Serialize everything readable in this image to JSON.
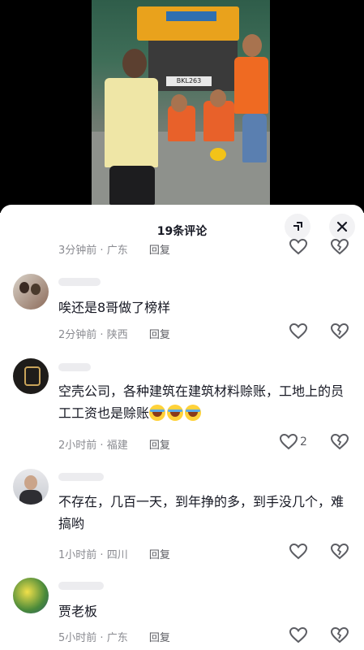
{
  "video": {
    "plate_text": "BKL263",
    "description_icon": "video-frame"
  },
  "sheet": {
    "title": "19条评论",
    "collapse_icon": "collapse-icon",
    "close_icon": "close-icon"
  },
  "comments": [
    {
      "meta_time": "3分钟前",
      "meta_loc": "广东",
      "reply": "回复",
      "text": "",
      "likes": ""
    },
    {
      "meta_time": "2分钟前",
      "meta_loc": "陕西",
      "reply": "回复",
      "text": "唉还是8哥做了榜样",
      "likes": ""
    },
    {
      "meta_time": "2小时前",
      "meta_loc": "福建",
      "reply": "回复",
      "text": "空壳公司，各种建筑在建筑材料赊账，工地上的员工工资也是赊账",
      "likes": "2"
    },
    {
      "meta_time": "1小时前",
      "meta_loc": "四川",
      "reply": "回复",
      "text": "不存在，几百一天，到年挣的多，到手没几个，难搞哟",
      "likes": ""
    },
    {
      "meta_time": "5小时前",
      "meta_loc": "广东",
      "reply": "回复",
      "text": "贾老板",
      "likes": ""
    }
  ],
  "colors": {
    "text": "#161823",
    "meta": "#8a8b91",
    "icon": "#5c5d63"
  }
}
